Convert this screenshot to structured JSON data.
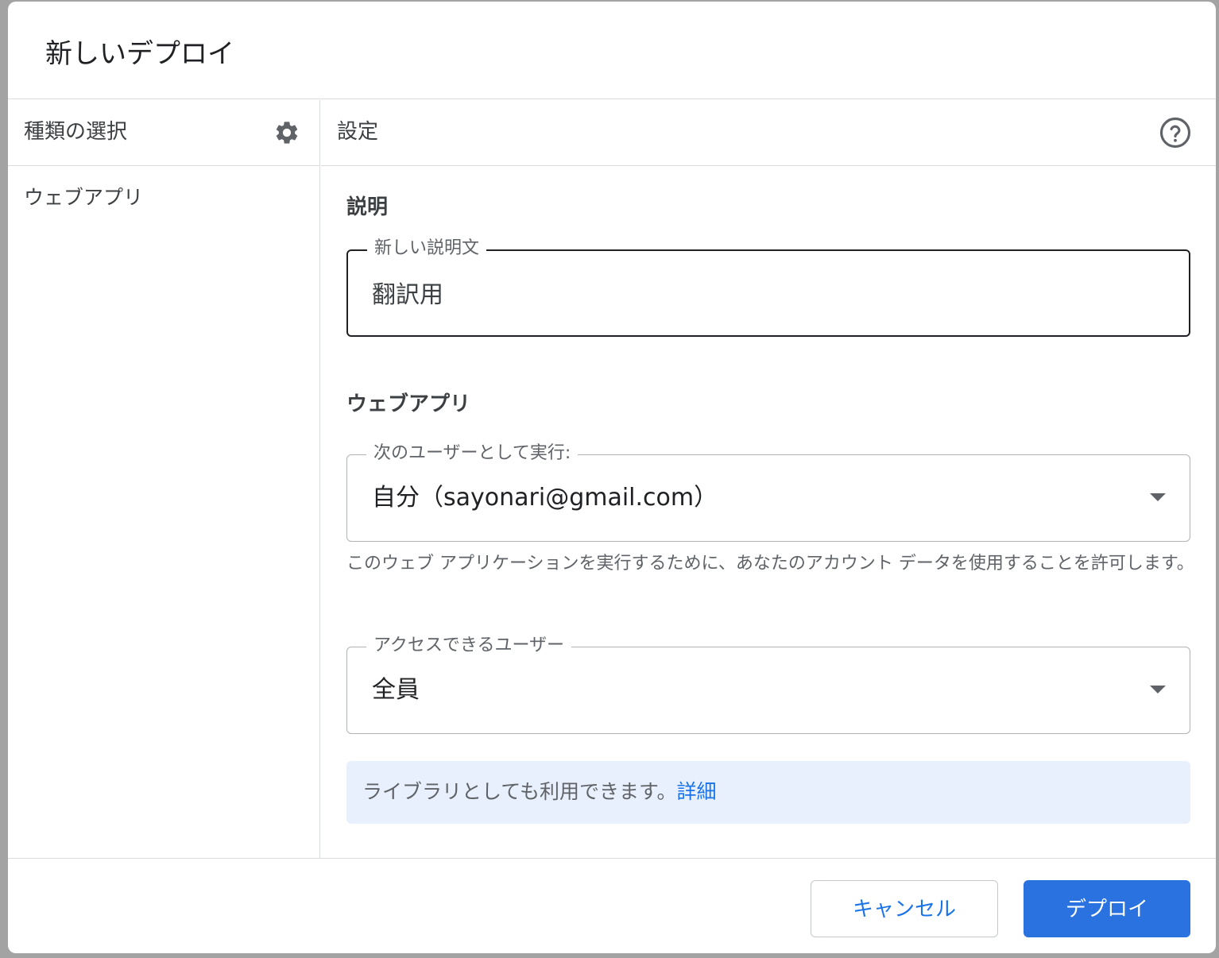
{
  "dialog": {
    "title": "新しいデプロイ"
  },
  "left_panel": {
    "header_label": "種類の選択",
    "settings_icon": "gear-icon",
    "items": [
      {
        "label": "ウェブアプリ"
      }
    ]
  },
  "right_panel": {
    "header_label": "設定",
    "help_icon": "help-circle-icon",
    "description_section": {
      "title": "説明",
      "field_label": "新しい説明文",
      "value": "翻訳用"
    },
    "webapp_section": {
      "title": "ウェブアプリ",
      "execute_as": {
        "label": "次のユーザーとして実行:",
        "value": "自分（sayonari@gmail.com）"
      },
      "helper_text": "このウェブ アプリケーションを実行するために、あなたのアカウント データを使用することを許可します。",
      "access": {
        "label": "アクセスできるユーザー",
        "value": "全員"
      }
    },
    "info": {
      "text": "ライブラリとしても利用できます。",
      "link": "詳細"
    }
  },
  "footer": {
    "cancel_label": "キャンセル",
    "deploy_label": "デプロイ"
  },
  "colors": {
    "accent": "#1a73e8",
    "primary_button": "#2a72e0",
    "info_background": "#e8f0fe",
    "divider": "#dadce0"
  }
}
